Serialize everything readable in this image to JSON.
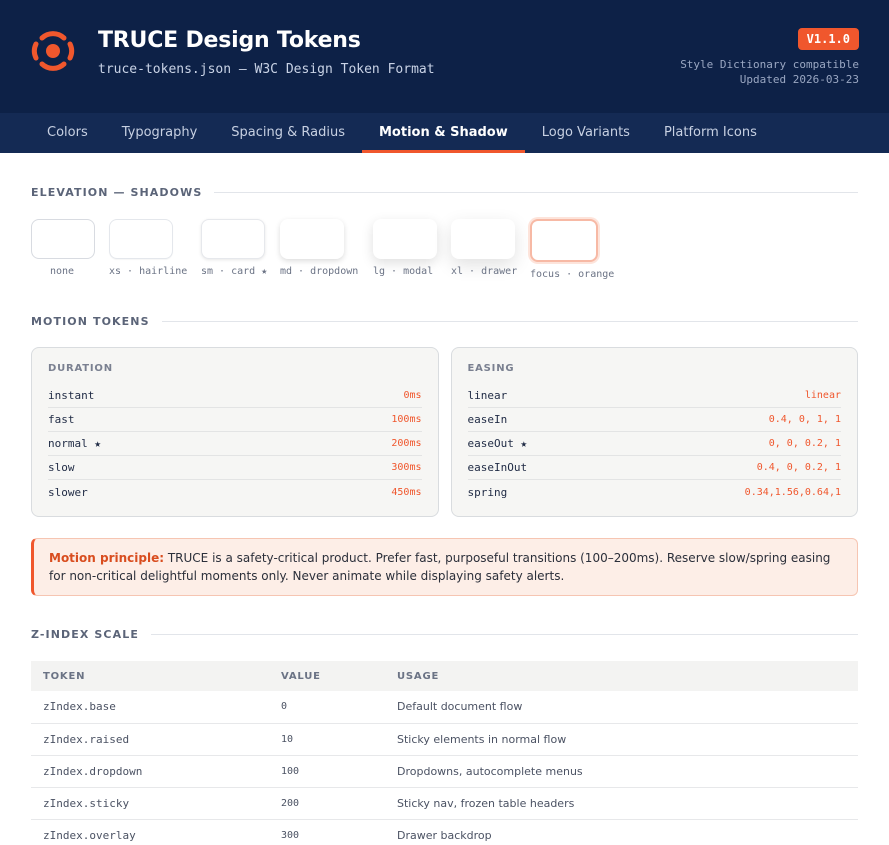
{
  "header": {
    "title": "TRUCE Design Tokens",
    "subtitle": "truce-tokens.json — W3C Design Token Format",
    "version": "V1.1.0",
    "compat_line1": "Style Dictionary compatible",
    "compat_line2": "Updated 2026-03-23",
    "logo_icon": "truce-logo-icon",
    "accent_color": "#f0572d",
    "bg_color": "#0d2147"
  },
  "tabs": [
    {
      "label": "Colors"
    },
    {
      "label": "Typography"
    },
    {
      "label": "Spacing & Radius"
    },
    {
      "label": "Motion & Shadow",
      "active": true
    },
    {
      "label": "Logo Variants"
    },
    {
      "label": "Platform Icons"
    }
  ],
  "elevation": {
    "heading": "ELEVATION — SHADOWS",
    "items": [
      {
        "label": "none"
      },
      {
        "label": "xs · hairline"
      },
      {
        "label": "sm · card ★"
      },
      {
        "label": "md · dropdown"
      },
      {
        "label": "lg · modal"
      },
      {
        "label": "xl · drawer"
      },
      {
        "label": "focus · orange"
      }
    ]
  },
  "motion": {
    "heading": "MOTION TOKENS",
    "duration": {
      "title": "DURATION",
      "rows": [
        {
          "k": "instant",
          "v": "0ms"
        },
        {
          "k": "fast",
          "v": "100ms"
        },
        {
          "k": "normal ★",
          "v": "200ms"
        },
        {
          "k": "slow",
          "v": "300ms"
        },
        {
          "k": "slower",
          "v": "450ms"
        }
      ]
    },
    "easing": {
      "title": "EASING",
      "rows": [
        {
          "k": "linear",
          "v": "linear"
        },
        {
          "k": "easeIn",
          "v": "0.4, 0, 1, 1"
        },
        {
          "k": "easeOut ★",
          "v": "0, 0, 0.2, 1"
        },
        {
          "k": "easeInOut",
          "v": "0.4, 0, 0.2, 1"
        },
        {
          "k": "spring",
          "v": "0.34,1.56,0.64,1"
        }
      ]
    }
  },
  "principle": {
    "bold": "Motion principle:",
    "text": " TRUCE is a safety-critical product. Prefer fast, purposeful transitions (100–200ms). Reserve slow/spring easing for non-critical delightful moments only. Never animate while displaying safety alerts."
  },
  "zindex": {
    "heading": "Z-INDEX SCALE",
    "columns": [
      "TOKEN",
      "VALUE",
      "USAGE"
    ],
    "rows": [
      {
        "token": "zIndex.base",
        "value": "0",
        "usage": "Default document flow"
      },
      {
        "token": "zIndex.raised",
        "value": "10",
        "usage": "Sticky elements in normal flow"
      },
      {
        "token": "zIndex.dropdown",
        "value": "100",
        "usage": "Dropdowns, autocomplete menus"
      },
      {
        "token": "zIndex.sticky",
        "value": "200",
        "usage": "Sticky nav, frozen table headers"
      },
      {
        "token": "zIndex.overlay",
        "value": "300",
        "usage": "Drawer backdrop"
      }
    ]
  }
}
